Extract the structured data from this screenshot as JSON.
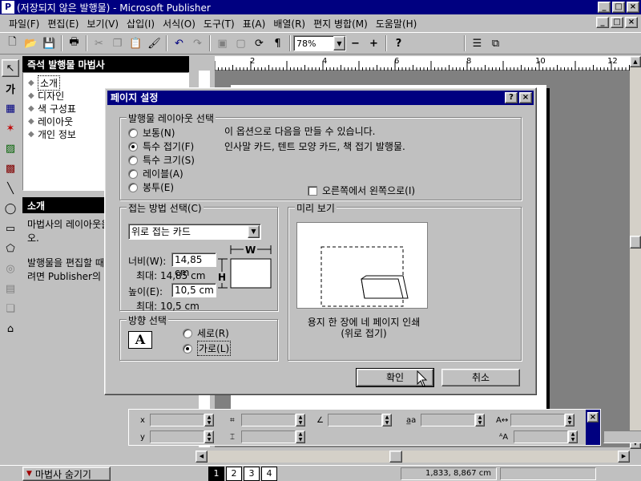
{
  "window": {
    "title": "(저장되지 않은 발행물) - Microsoft Publisher",
    "app_icon": "P",
    "caption_buttons": [
      "_",
      "□",
      "×"
    ]
  },
  "menu": [
    "파일(F)",
    "편집(E)",
    "보기(V)",
    "삽입(I)",
    "서식(O)",
    "도구(T)",
    "표(A)",
    "배열(R)",
    "편지 병합(M)",
    "도움말(H)"
  ],
  "toolbar": {
    "zoom": "78%",
    "zoom_out": "−",
    "zoom_in": "+"
  },
  "wizard": {
    "title": "즉석 발행물 마법사",
    "items": [
      "소개",
      "디자인",
      "색 구성표",
      "레이아웃",
      "개인 정보"
    ],
    "selected_index": 0
  },
  "info_panel": {
    "title": "소개",
    "paragraph1": "마법사의 레이아웃을 꾸려면 위에 있는 오.",
    "paragraph2": "발행물을 편집할 때 식 옵션을 사용할 려면 Publisher의 체적으로 검토해 ."
  },
  "dialog": {
    "title": "페이지 설정",
    "help_btn": "?",
    "close_btn": "×",
    "layout_group": "발행물 레이아웃 선택",
    "layout_options": [
      "보통(N)",
      "특수 접기(F)",
      "특수 크기(S)",
      "레이블(A)",
      "봉투(E)"
    ],
    "layout_selected": 1,
    "layout_desc_line1": "이 옵션으로 다음을 만들 수 있습니다.",
    "layout_desc_line2": "인사말 카드, 텐트 모양 카드, 책 접기 발행물.",
    "rtl_checkbox": "오른쪽에서 왼쪽으로(I)",
    "fold_group": "접는 방법 선택(C)",
    "fold_value": "위로 접는 카드",
    "width_label": "너비(W):",
    "width_value": "14,85 cm",
    "width_max": "최대: 14,85 cm",
    "height_label": "높이(E):",
    "height_value": "10,5 cm",
    "height_max": "최대: 10,5 cm",
    "diagram_w": "W",
    "diagram_h": "H",
    "orientation_group": "방향 선택",
    "orientation_icon": "A",
    "orientation_options": [
      "세로(R)",
      "가로(L)"
    ],
    "orientation_selected": 1,
    "preview_group": "미리 보기",
    "preview_caption1": "용지 한 장에 네 페이지 인쇄",
    "preview_caption2": "(위로 접기)",
    "ok": "확인",
    "cancel": "취소"
  },
  "ruler_labels": [
    "2",
    "4",
    "6",
    "8",
    "10",
    "12"
  ],
  "measure_labels": {
    "x": "x",
    "y": "y"
  },
  "status": {
    "hide_wizard": "마법사 숨기기",
    "pages": [
      "1",
      "2",
      "3",
      "4"
    ],
    "active_page": 0,
    "coords": "1,833, 8,867 cm"
  }
}
